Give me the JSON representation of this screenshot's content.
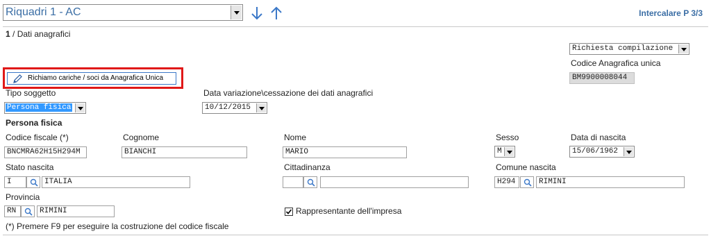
{
  "header": {
    "section_select": "Riquadri 1 - AC",
    "intercalare": "Intercalare P 3/3",
    "breadcrumb_num": "1",
    "breadcrumb_text": " / Dati anagrafici"
  },
  "richiesta": {
    "value": "Richiesta compilazione"
  },
  "codice_anagrafica": {
    "label": "Codice Anagrafica unica",
    "value": "BM9900008044"
  },
  "richiamo_button": "Richiamo cariche / soci da Anagrafica Unica",
  "tipo_soggetto": {
    "label": "Tipo soggetto",
    "value": "Persona fisica"
  },
  "data_variazione": {
    "label": "Data variazione\\cessazione dei dati anagrafici",
    "value": "10/12/2015"
  },
  "persona_fisica": {
    "title": "Persona fisica",
    "codice_fiscale": {
      "label": "Codice fiscale (*)",
      "value": "BNCMRA62H15H294M"
    },
    "cognome": {
      "label": "Cognome",
      "value": "BIANCHI"
    },
    "nome": {
      "label": "Nome",
      "value": "MARIO"
    },
    "sesso": {
      "label": "Sesso",
      "value": "M"
    },
    "data_nascita": {
      "label": "Data di nascita",
      "value": "15/06/1962"
    },
    "stato_nascita": {
      "label": "Stato nascita",
      "code": "I",
      "name": "ITALIA"
    },
    "cittadinanza": {
      "label": "Cittadinanza",
      "code": "",
      "name": ""
    },
    "comune_nascita": {
      "label": "Comune nascita",
      "code": "H294",
      "name": "RIMINI"
    },
    "provincia": {
      "label": "Provincia",
      "code": "RN",
      "name": "RIMINI"
    },
    "rappresentante": {
      "label": "Rappresentante dell'impresa",
      "checked": true
    }
  },
  "footnote": "(*) Premere F9 per eseguire la costruzione del codice fiscale",
  "colors": {
    "accent": "#3b6ea5",
    "highlight_red": "#e01818",
    "selection": "#3399ff"
  }
}
